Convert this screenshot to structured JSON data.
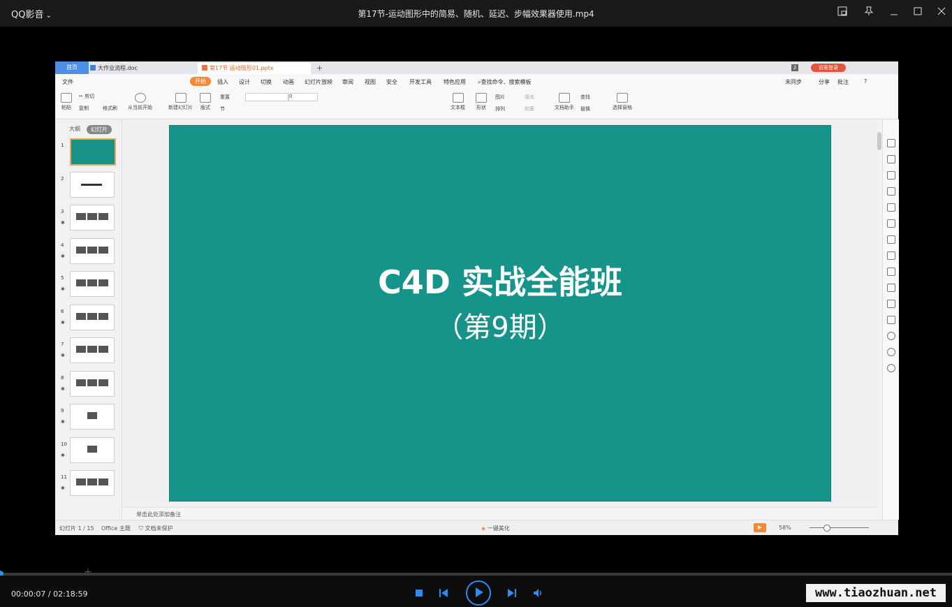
{
  "player": {
    "app_name": "QQ影音",
    "video_title": "第17节-运动图形中的简易、随机、延迟、步幅效果器使用.mp4",
    "time_current": "00:00:07",
    "time_total": "02:18:59",
    "time_separator": " / ",
    "progress": 0.001,
    "accent_color": "#2d8cf0",
    "icons": [
      "chevron-down-icon",
      "pip-icon",
      "pin-icon",
      "minimize-icon",
      "maximize-icon",
      "close-icon",
      "stop-icon",
      "previous-icon",
      "play-icon",
      "next-icon",
      "volume-icon"
    ]
  },
  "wps": {
    "tabs": {
      "home": "首页",
      "doc": "大作业流程.doc",
      "ppt": "第17节 运动图形01.pptx",
      "plus": "+"
    },
    "login": "访客登录",
    "badge": "2",
    "menu": [
      "文件",
      "开始",
      "插入",
      "设计",
      "切换",
      "动画",
      "幻灯片放映",
      "审阅",
      "视图",
      "安全",
      "开发工具",
      "特色应用",
      "查找命令、搜索模板"
    ],
    "menu_right": [
      "未同步",
      "分享",
      "批注",
      "?"
    ],
    "ribbon": {
      "paste": "粘贴",
      "cut": "剪切",
      "copy": "复制",
      "format_painter": "格式刷",
      "from_current": "从当前开始",
      "new_slide": "新建幻灯片",
      "layout": "版式",
      "reset": "重置",
      "section": "节",
      "font_size": "0",
      "textbox": "文本框",
      "shape": "形状",
      "picture": "图片",
      "arrange": "排列",
      "fill": "填充",
      "outline": "轮廓",
      "find": "查找",
      "replace": "替换",
      "doc_helper": "文档助手",
      "select_pane": "选择窗格"
    },
    "panel_tabs": [
      "大纲",
      "幻灯片"
    ],
    "slides": [
      "1",
      "2",
      "3",
      "4",
      "5",
      "6",
      "7",
      "8",
      "9",
      "10",
      "11"
    ],
    "slide": {
      "title": "C4D 实战全能班",
      "subtitle": "（第9期）",
      "bg_color": "#17948a"
    },
    "notes_placeholder": "单击此处添加备注",
    "status": {
      "slide_count": "幻灯片 1 / 15",
      "theme": "Office 主题",
      "protect": "文档未保护",
      "beautify": "一键美化",
      "zoom": "58%"
    }
  },
  "watermark": "www.tiaozhuan.net"
}
